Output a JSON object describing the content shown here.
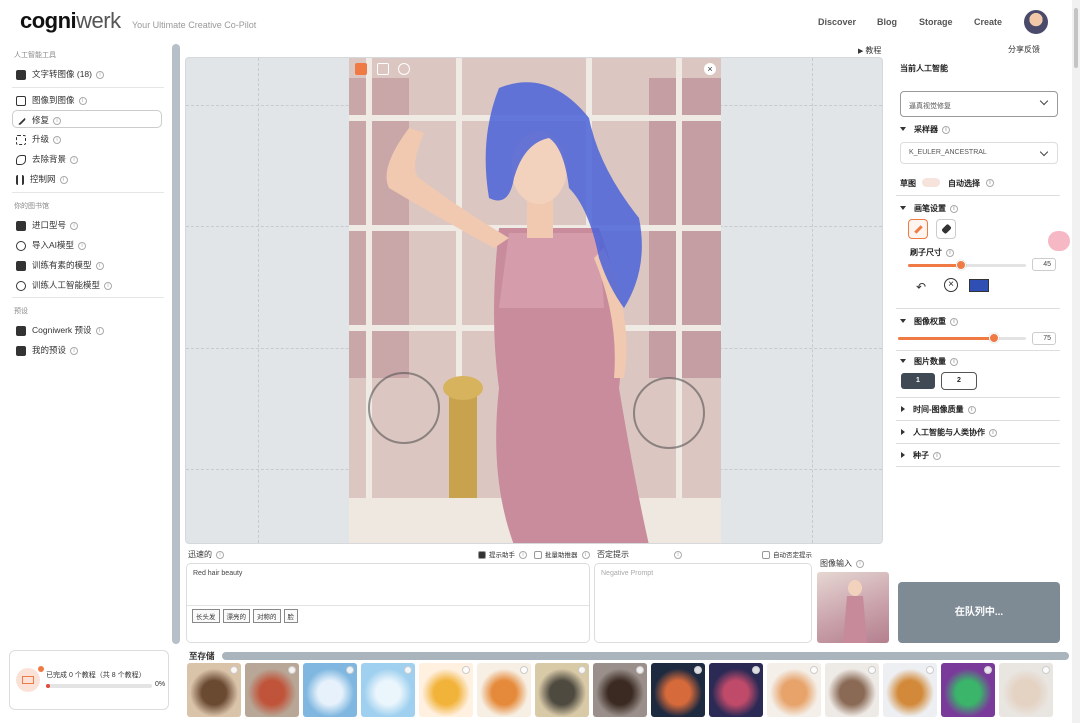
{
  "app": {
    "logo_bold": "cogni",
    "logo_light": "werk",
    "tagline": "Your Ultimate Creative Co-Pilot"
  },
  "nav": [
    "Discover",
    "Blog",
    "Storage",
    "Create"
  ],
  "sidebar": {
    "sections": [
      {
        "title": "人工智能工具",
        "items": [
          "文字转图像 (18)",
          "图像到图像",
          "修复",
          "升级",
          "去除背景",
          "控制网"
        ]
      },
      {
        "title": "你的图书馆",
        "items": [
          "进口型号",
          "导入AI模型",
          "训练有素的模型",
          "训练人工智能模型"
        ]
      },
      {
        "title": "预设",
        "items": [
          "Cogniwerk 预设",
          "我的预设"
        ]
      }
    ],
    "active_item": "修复"
  },
  "canvas": {
    "tutorial_label": "教程"
  },
  "prompt": {
    "label": "迅速的",
    "assist_label": "提示助手",
    "batch_label": "批量助推器",
    "value": "Red hair beauty",
    "tags": [
      "长头发",
      "漂亮的",
      "对称的",
      "脸"
    ],
    "negative_label": "否定提示",
    "auto_negative_label": "自动否定提示",
    "negative_placeholder": "Negative Prompt",
    "image_input_label": "图像输入"
  },
  "right_panel": {
    "feedback": "分享反馈",
    "current_ai_label": "当前人工智能",
    "current_ai_value": "逼真视觉修复",
    "sampler_label": "采样器",
    "sampler_value": "K_EULER_ANCESTRAL",
    "sketch_label": "草图",
    "auto_select_label": "自动选择",
    "brush_settings_label": "画笔设置",
    "brush_size_label": "刷子尺寸",
    "brush_size": 45,
    "brush_size_max": 100,
    "brush_color": "#2f4fb5",
    "image_weight_label": "图像权重",
    "image_weight": 75,
    "image_weight_max": 100,
    "image_count_label": "图片数量",
    "image_count_options": [
      "1",
      "2"
    ],
    "image_count_selected": "1",
    "collapsed_sections": [
      "时间-图像质量",
      "人工智能与人类协作",
      "种子"
    ],
    "queue_button": "在队列中..."
  },
  "progress": {
    "text": "已完成 0 个教程（共 8 个教程）",
    "percent": "0%"
  },
  "storage": {
    "label": "至存储"
  },
  "colors": {
    "accent": "#f07a44",
    "queue_button": "#7e8b95",
    "mask": "#4a63d8"
  },
  "icons": [
    "text-to-image-icon",
    "image-to-image-icon",
    "brush-icon",
    "upscale-icon",
    "eraser-icon",
    "controlnet-icon",
    "model-icon",
    "plus-circle-icon",
    "train-icon",
    "preset-icon",
    "user-icon",
    "download-icon",
    "info-icon",
    "close-icon",
    "undo-icon",
    "clear-icon"
  ]
}
